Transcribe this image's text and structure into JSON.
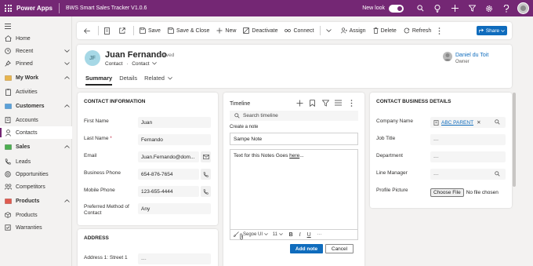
{
  "header": {
    "app_name": "Power Apps",
    "app_title": "BWS Smart Sales Tracker V1.0.6",
    "new_look_label": "New look",
    "brand_color": "#742774"
  },
  "sidebar": {
    "items": [
      {
        "label": "Home",
        "icon": "home-icon"
      },
      {
        "label": "Recent",
        "icon": "clock-icon"
      },
      {
        "label": "Pinned",
        "icon": "pin-icon"
      },
      {
        "label": "My Work",
        "icon": "group-icon"
      },
      {
        "label": "Activities",
        "icon": "clipboard-icon"
      },
      {
        "label": "Customers",
        "icon": "customers-icon"
      },
      {
        "label": "Accounts",
        "icon": "building-icon"
      },
      {
        "label": "Contacts",
        "icon": "person-icon"
      },
      {
        "label": "Sales",
        "icon": "sales-icon"
      },
      {
        "label": "Leads",
        "icon": "phone-icon"
      },
      {
        "label": "Opportunities",
        "icon": "opportunity-icon"
      },
      {
        "label": "Competitors",
        "icon": "competitor-icon"
      },
      {
        "label": "Products",
        "icon": "products-icon"
      },
      {
        "label": "Products",
        "icon": "box-icon"
      },
      {
        "label": "Warranties",
        "icon": "warranty-icon"
      }
    ]
  },
  "commandbar": {
    "save": "Save",
    "save_close": "Save & Close",
    "new": "New",
    "deactivate": "Deactivate",
    "connect": "Connect",
    "assign": "Assign",
    "delete": "Delete",
    "refresh": "Refresh",
    "share": "Share"
  },
  "record": {
    "initials": "JF",
    "name": "Juan Fernando",
    "saved": "- Saved",
    "entity": "Contact",
    "form": "Contact",
    "owner_name": "Daniel du Toit",
    "owner_label": "Owner",
    "tabs": [
      "Summary",
      "Details",
      "Related"
    ]
  },
  "contact_info": {
    "title": "CONTACT INFORMATION",
    "fields": [
      {
        "label": "First Name",
        "value": "Juan"
      },
      {
        "label": "Last Name",
        "required": "*",
        "value": "Fernando"
      },
      {
        "label": "Email",
        "value": "Juan.Fernando@dom..."
      },
      {
        "label": "Business Phone",
        "value": "654-876-7654"
      },
      {
        "label": "Mobile Phone",
        "value": "123-655-4444"
      },
      {
        "label": "Preferred Method of Contact",
        "value": "Any"
      }
    ]
  },
  "address": {
    "title": "ADDRESS",
    "fields": [
      {
        "label": "Address 1: Street 1",
        "value": "---"
      }
    ]
  },
  "timeline": {
    "title": "Timeline",
    "search_placeholder": "Search timeline",
    "create_note": "Create a note",
    "note_title": "Sampe Note",
    "note_text": "Text for this Notes Goes ",
    "note_link": "here",
    "note_text_end": "...",
    "font": "Segoe UI",
    "font_size": "11",
    "add_note": "Add note",
    "cancel": "Cancel",
    "accent_color": "#0f6cbd"
  },
  "business": {
    "title": "CONTACT BUSINESS DETAILS",
    "fields": [
      {
        "label": "Company Name",
        "value": "ABC PARENT"
      },
      {
        "label": "Job Title",
        "value": "---"
      },
      {
        "label": "Department",
        "value": "---"
      },
      {
        "label": "Line Manager",
        "value": "---"
      },
      {
        "label": "Profile Picture",
        "button": "Choose File",
        "status": "No file chosen"
      }
    ]
  }
}
